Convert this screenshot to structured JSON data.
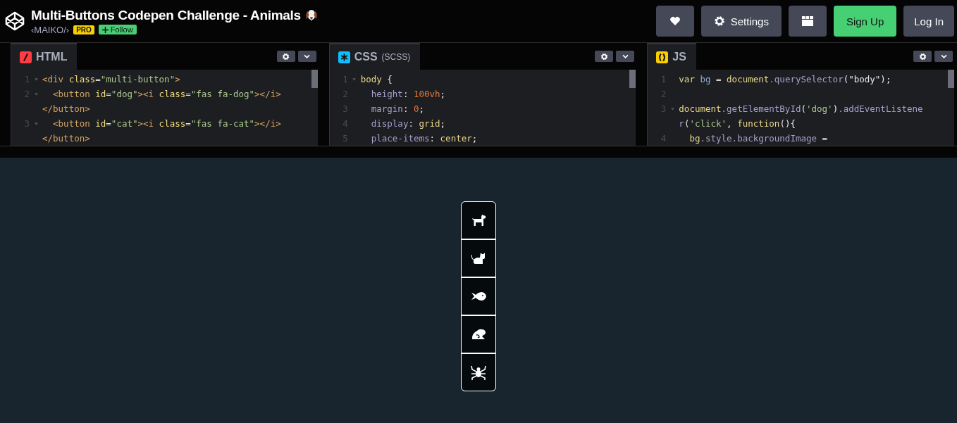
{
  "header": {
    "title": "Multi-Buttons Codepen Challenge - Animals",
    "author": "‹MAIKO/›",
    "badge": "PRO",
    "follow": "Follow"
  },
  "actions": [
    {
      "kind": "heart"
    },
    {
      "kind": "settings",
      "label": "Settings"
    },
    {
      "kind": "layout"
    },
    {
      "kind": "signup",
      "label": "Sign Up"
    },
    {
      "kind": "login",
      "label": "Log In"
    }
  ],
  "editors": [
    {
      "kind": "html",
      "title": "HTML",
      "lines": [
        {
          "number": "1",
          "fold": true,
          "segments": [
            {
              "kind": "tag",
              "text": "<div "
            },
            {
              "kind": "attr",
              "text": "class"
            },
            {
              "kind": "plain",
              "text": "="
            },
            {
              "kind": "str",
              "text": "\"multi-button\""
            },
            {
              "kind": "tag",
              "text": ">"
            }
          ]
        },
        {
          "number": "2",
          "fold": true,
          "segments": [
            {
              "kind": "tag",
              "text": "  <button "
            },
            {
              "kind": "attr",
              "text": "id"
            },
            {
              "kind": "plain",
              "text": "="
            },
            {
              "kind": "str",
              "text": "\"dog\""
            },
            {
              "kind": "tag",
              "text": "><i "
            },
            {
              "kind": "attr",
              "text": "class"
            },
            {
              "kind": "plain",
              "text": "="
            },
            {
              "kind": "str",
              "text": "\"fas fa-dog\""
            },
            {
              "kind": "tag",
              "text": "></i>"
            }
          ]
        },
        {
          "fold": false,
          "segments": [
            {
              "kind": "tag",
              "text": "</button>"
            }
          ]
        },
        {
          "number": "3",
          "fold": true,
          "segments": [
            {
              "kind": "tag",
              "text": "  <button "
            },
            {
              "kind": "attr",
              "text": "id"
            },
            {
              "kind": "plain",
              "text": "="
            },
            {
              "kind": "str",
              "text": "\"cat\""
            },
            {
              "kind": "tag",
              "text": "><i "
            },
            {
              "kind": "attr",
              "text": "class"
            },
            {
              "kind": "plain",
              "text": "="
            },
            {
              "kind": "str",
              "text": "\"fas fa-cat\""
            },
            {
              "kind": "tag",
              "text": "></i>"
            }
          ]
        },
        {
          "fold": false,
          "segments": [
            {
              "kind": "tag",
              "text": "</button>"
            }
          ]
        }
      ]
    },
    {
      "kind": "css",
      "title": "CSS",
      "subtitle": "(SCSS)",
      "lines": [
        {
          "number": "1",
          "fold": true,
          "segments": [
            {
              "kind": "val",
              "text": "body "
            },
            {
              "kind": "plain",
              "text": "{"
            }
          ]
        },
        {
          "number": "2",
          "fold": false,
          "segments": [
            {
              "kind": "prop",
              "text": "  height"
            },
            {
              "kind": "plain",
              "text": ": "
            },
            {
              "kind": "num",
              "text": "100vh"
            },
            {
              "kind": "plain",
              "text": ";"
            }
          ]
        },
        {
          "number": "3",
          "fold": false,
          "segments": [
            {
              "kind": "prop",
              "text": "  margin"
            },
            {
              "kind": "plain",
              "text": ": "
            },
            {
              "kind": "num",
              "text": "0"
            },
            {
              "kind": "plain",
              "text": ";"
            }
          ]
        },
        {
          "number": "4",
          "fold": false,
          "segments": [
            {
              "kind": "prop",
              "text": "  display"
            },
            {
              "kind": "plain",
              "text": ": "
            },
            {
              "kind": "val",
              "text": "grid"
            },
            {
              "kind": "plain",
              "text": ";"
            }
          ]
        },
        {
          "number": "5",
          "fold": false,
          "segments": [
            {
              "kind": "prop",
              "text": "  place-items"
            },
            {
              "kind": "plain",
              "text": ": "
            },
            {
              "kind": "val",
              "text": "center"
            },
            {
              "kind": "plain",
              "text": ";"
            }
          ]
        }
      ]
    },
    {
      "kind": "js",
      "title": "JS",
      "lines": [
        {
          "number": "1",
          "fold": false,
          "segments": [
            {
              "kind": "val",
              "text": "var "
            },
            {
              "kind": "var",
              "text": "bg"
            },
            {
              "kind": "plain",
              "text": " = "
            },
            {
              "kind": "val",
              "text": "document"
            },
            {
              "kind": "prop",
              "text": ".querySelector"
            },
            {
              "kind": "plain",
              "text": "(\"body\");"
            }
          ]
        },
        {
          "number": "2",
          "fold": false
        },
        {
          "number": "3",
          "fold": true,
          "segments": [
            {
              "kind": "val",
              "text": "document"
            },
            {
              "kind": "prop",
              "text": ".getElementById"
            },
            {
              "kind": "plain",
              "text": "("
            },
            {
              "kind": "str",
              "text": "'dog'"
            },
            {
              "kind": "plain",
              "text": ")"
            },
            {
              "kind": "prop",
              "text": ".addEventListene"
            }
          ]
        },
        {
          "fold": false,
          "segments": [
            {
              "kind": "prop",
              "text": "r"
            },
            {
              "kind": "plain",
              "text": "("
            },
            {
              "kind": "str",
              "text": "'click'"
            },
            {
              "kind": "plain",
              "text": ", "
            },
            {
              "kind": "val",
              "text": "function"
            },
            {
              "kind": "plain",
              "text": "(){"
            }
          ]
        },
        {
          "number": "4",
          "fold": false,
          "segments": [
            {
              "kind": "val",
              "text": "  bg"
            },
            {
              "kind": "prop",
              "text": ".style.backgroundImage"
            },
            {
              "kind": "plain",
              "text": " ="
            }
          ]
        }
      ]
    }
  ],
  "animal_buttons": [
    {
      "kind": "dog"
    },
    {
      "kind": "cat"
    },
    {
      "kind": "fish"
    },
    {
      "kind": "frog"
    },
    {
      "kind": "spider"
    }
  ]
}
